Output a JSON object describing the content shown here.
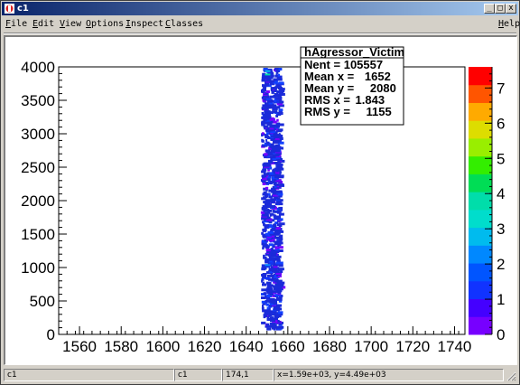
{
  "window": {
    "title": "c1",
    "minimize_glyph": "_",
    "maximize_glyph": "□",
    "close_glyph": "x",
    "icon": "root-app-icon"
  },
  "menu": {
    "file": {
      "u": "F",
      "rest": "ile"
    },
    "edit": {
      "u": "E",
      "rest": "dit"
    },
    "view": {
      "u": "V",
      "rest": "iew"
    },
    "options": {
      "u": "O",
      "rest": "ptions"
    },
    "inspect": {
      "u": "I",
      "rest": "nspect"
    },
    "classes": {
      "u": "C",
      "rest": "lasses"
    },
    "help": {
      "u": "H",
      "rest": "elp"
    }
  },
  "stats": {
    "name": "hAgressor_Victim",
    "lines": [
      {
        "label": "Nent = ",
        "value": "105557"
      },
      {
        "label": "Mean x = ",
        "value": "1652"
      },
      {
        "label": "Mean y = ",
        "value": "2080"
      },
      {
        "label": "RMS x = ",
        "value": "1.843"
      },
      {
        "label": "RMS y = ",
        "value": "1155"
      }
    ]
  },
  "status": {
    "cell1": "c1",
    "cell2": "c1",
    "cell3": "174,1",
    "cell4": "x=1.59e+03, y=4.49e+03"
  },
  "colors": {
    "palette": [
      "#7700ff",
      "#4400ff",
      "#1133ff",
      "#0055ff",
      "#0088ff",
      "#00bbee",
      "#00ddcc",
      "#00ddaa",
      "#00dd55",
      "#33ee00",
      "#99ee00",
      "#dddd00",
      "#ffaa00",
      "#ff5500",
      "#ff0000"
    ],
    "points": "#1a2bd9"
  },
  "chart_data": {
    "type": "heatmap",
    "title": "",
    "xlabel": "",
    "ylabel": "",
    "xlim": [
      1550,
      1745
    ],
    "ylim": [
      0,
      4000
    ],
    "x_ticks": [
      1560,
      1580,
      1600,
      1620,
      1640,
      1660,
      1680,
      1700,
      1720,
      1740
    ],
    "y_ticks": [
      0,
      500,
      1000,
      1500,
      2000,
      2500,
      3000,
      3500,
      4000
    ],
    "z_ticks": [
      0,
      1,
      2,
      3,
      4,
      5,
      6,
      7
    ],
    "zlim": [
      0,
      7.6
    ],
    "band_x_range": [
      1647,
      1656
    ],
    "band_y_range": [
      100,
      4000
    ],
    "stats": {
      "entries": 105557,
      "mean_x": 1652,
      "mean_y": 2080,
      "rms_x": 1.843,
      "rms_y": 1155
    }
  }
}
